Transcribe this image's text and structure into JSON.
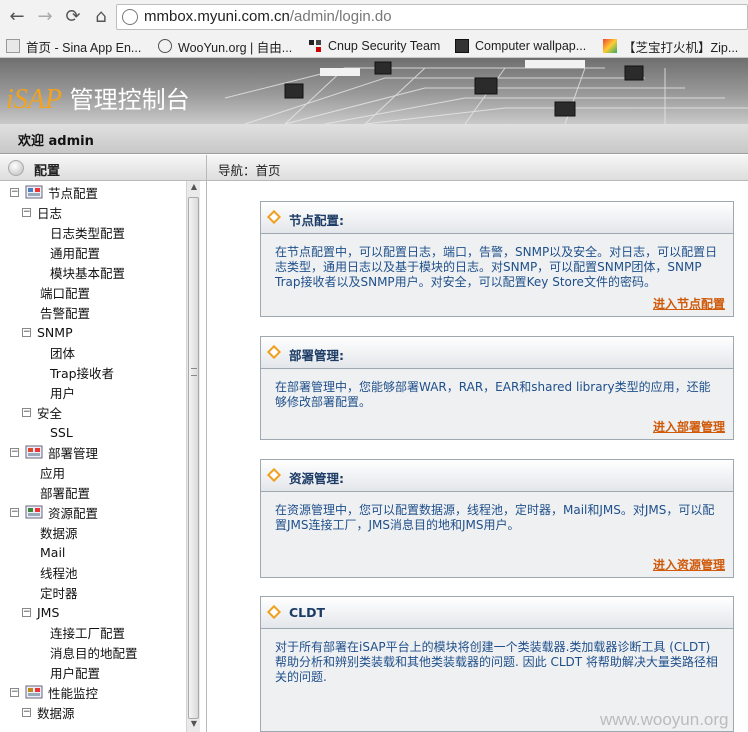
{
  "browser": {
    "url_domain": "mmbox.myuni.com.cn",
    "url_path": "/admin/login.do",
    "bookmarks": [
      {
        "label": "首页 - Sina App En...",
        "icon": "sina-icon"
      },
      {
        "label": "WooYun.org | 自由...",
        "icon": "wooyun-icon"
      },
      {
        "label": "Cnup Security Team",
        "icon": "cnup-icon"
      },
      {
        "label": "Computer wallpap...",
        "icon": "wallpaper-icon"
      },
      {
        "label": "【芝宝打火机】Zip...",
        "icon": "zippo-icon"
      }
    ]
  },
  "app": {
    "brand_logo": "iSAP",
    "brand_title": "管理控制台",
    "welcome": "欢迎 admin",
    "panel_title": "配置",
    "breadcrumb": "导航：首页"
  },
  "tree": [
    {
      "label": "节点配置",
      "level": 0,
      "toggle": "−",
      "icon": "node-config-icon"
    },
    {
      "label": "日志",
      "level": 1,
      "toggle": "−"
    },
    {
      "label": "日志类型配置",
      "level": 2
    },
    {
      "label": "通用配置",
      "level": 2
    },
    {
      "label": "模块基本配置",
      "level": 2
    },
    {
      "label": "端口配置",
      "level": 1
    },
    {
      "label": "告警配置",
      "level": 1
    },
    {
      "label": "SNMP",
      "level": 1,
      "toggle": "−"
    },
    {
      "label": "团体",
      "level": 2
    },
    {
      "label": "Trap接收者",
      "level": 2
    },
    {
      "label": "用户",
      "level": 2
    },
    {
      "label": "安全",
      "level": 1,
      "toggle": "−"
    },
    {
      "label": "SSL",
      "level": 2
    },
    {
      "label": "部署管理",
      "level": 0,
      "toggle": "−",
      "icon": "deploy-icon"
    },
    {
      "label": "应用",
      "level": 1
    },
    {
      "label": "部署配置",
      "level": 1
    },
    {
      "label": "资源配置",
      "level": 0,
      "toggle": "−",
      "icon": "resource-icon"
    },
    {
      "label": "数据源",
      "level": 1
    },
    {
      "label": "Mail",
      "level": 1
    },
    {
      "label": "线程池",
      "level": 1
    },
    {
      "label": "定时器",
      "level": 1
    },
    {
      "label": "JMS",
      "level": 1,
      "toggle": "−"
    },
    {
      "label": "连接工厂配置",
      "level": 2
    },
    {
      "label": "消息目的地配置",
      "level": 2
    },
    {
      "label": "用户配置",
      "level": 2
    },
    {
      "label": "性能监控",
      "level": 0,
      "toggle": "−",
      "icon": "monitor-icon"
    },
    {
      "label": "数据源",
      "level": 1,
      "toggle": "−"
    }
  ],
  "cards": [
    {
      "title": "节点配置:",
      "body": "在节点配置中，可以配置日志，端口，告警，SNMP以及安全。对日志，可以配置日志类型，通用日志以及基于模块的日志。对SNMP，可以配置SNMP团体，SNMP Trap接收者以及SNMP用户。对安全，可以配置Key Store文件的密码。",
      "link": "进入节点配置"
    },
    {
      "title": "部署管理:",
      "body": "在部署管理中，您能够部署WAR，RAR，EAR和shared library类型的应用，还能够修改部署配置。",
      "link": "进入部署管理"
    },
    {
      "title": "资源管理:",
      "body": "在资源管理中，您可以配置数据源，线程池，定时器，Mail和JMS。对JMS，可以配置JMS连接工厂，JMS消息目的地和JMS用户。",
      "link": "进入资源管理"
    },
    {
      "title": "CLDT",
      "body": "对于所有部署在iSAP平台上的模块将创建一个类装载器.类加载器诊断工具 (CLDT) 帮助分析和辨别类装载和其他类装载器的问题. 因此 CLDT 将帮助解决大量类路径相关的问题.",
      "link": ""
    }
  ],
  "watermark": "www.wooyun.org"
}
